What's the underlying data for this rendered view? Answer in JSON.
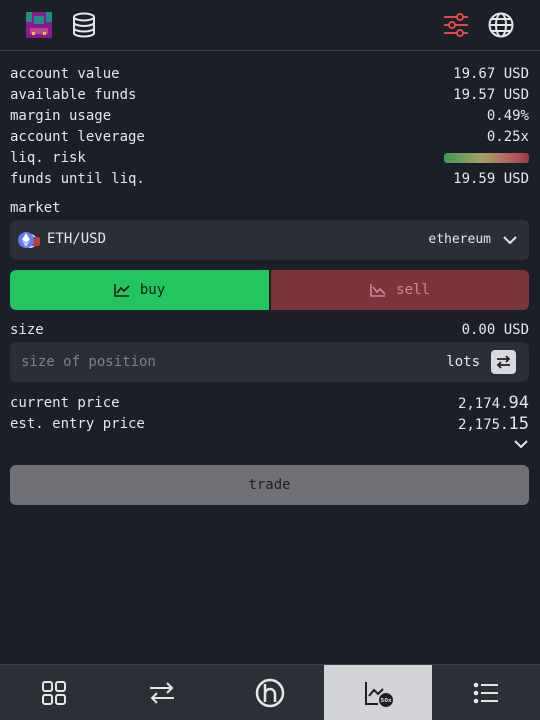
{
  "header": {
    "icons": [
      "app-logo-icon",
      "database-icon",
      "settings-sliders-icon",
      "globe-icon"
    ]
  },
  "account": {
    "value_label": "account value",
    "value": "19.67 USD",
    "funds_label": "available funds",
    "funds": "19.57 USD",
    "margin_label": "margin usage",
    "margin": "0.49%",
    "leverage_label": "account leverage",
    "leverage": "0.25x",
    "risk_label": "liq. risk",
    "until_label": "funds until liq.",
    "until": "19.59 USD"
  },
  "market": {
    "label": "market",
    "pair": "ETH/USD",
    "chain": "ethereum"
  },
  "side": {
    "buy": "buy",
    "sell": "sell",
    "selected": "buy"
  },
  "size": {
    "label": "size",
    "value": "0.00 USD",
    "placeholder": "size of position",
    "unit": "lots"
  },
  "prices": {
    "current_label": "current price",
    "current_main": "2,174.",
    "current_tail": "94",
    "entry_label": "est. entry price",
    "entry_main": "2,175.",
    "entry_tail": "15"
  },
  "trade": {
    "label": "trade"
  },
  "nav": {
    "items": [
      "grid-icon",
      "swap-icon",
      "brand-h-icon",
      "chart-icon",
      "list-icon"
    ],
    "active": "chart-icon",
    "chart_badge": "50x"
  },
  "colors": {
    "background": "#1b1f27",
    "buy": "#22c55e",
    "sell": "#7c3339",
    "settings_accent": "#e04a4a"
  }
}
